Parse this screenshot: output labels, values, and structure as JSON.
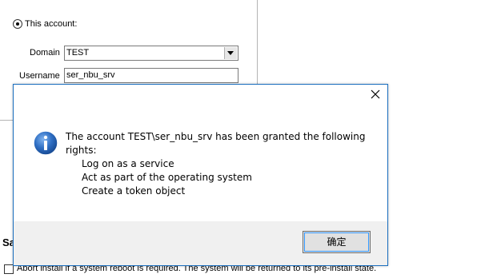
{
  "account": {
    "radio_label": "This account:",
    "domain_label": "Domain",
    "domain_value": "TEST",
    "username_label": "Username",
    "username_value": "ser_nbu_srv"
  },
  "section_fragment": "Sa",
  "abort_option": {
    "label": "Abort install if a system reboot is required. The system will be returned to its pre-install state."
  },
  "dialog": {
    "message_line1": "The account TEST\\ser_nbu_srv has been granted the following",
    "message_line2": "rights:",
    "rights": [
      "Log on as a service",
      "Act as part of the operating system",
      "Create a token object"
    ],
    "ok_label": "确定",
    "close_icon": "close-icon",
    "info_icon": "info-icon"
  },
  "colors": {
    "dialog_border": "#1b6fbf",
    "info_icon": "#1f5fb0",
    "footer": "#f0f0f0",
    "button_focus": "#3399ff"
  }
}
